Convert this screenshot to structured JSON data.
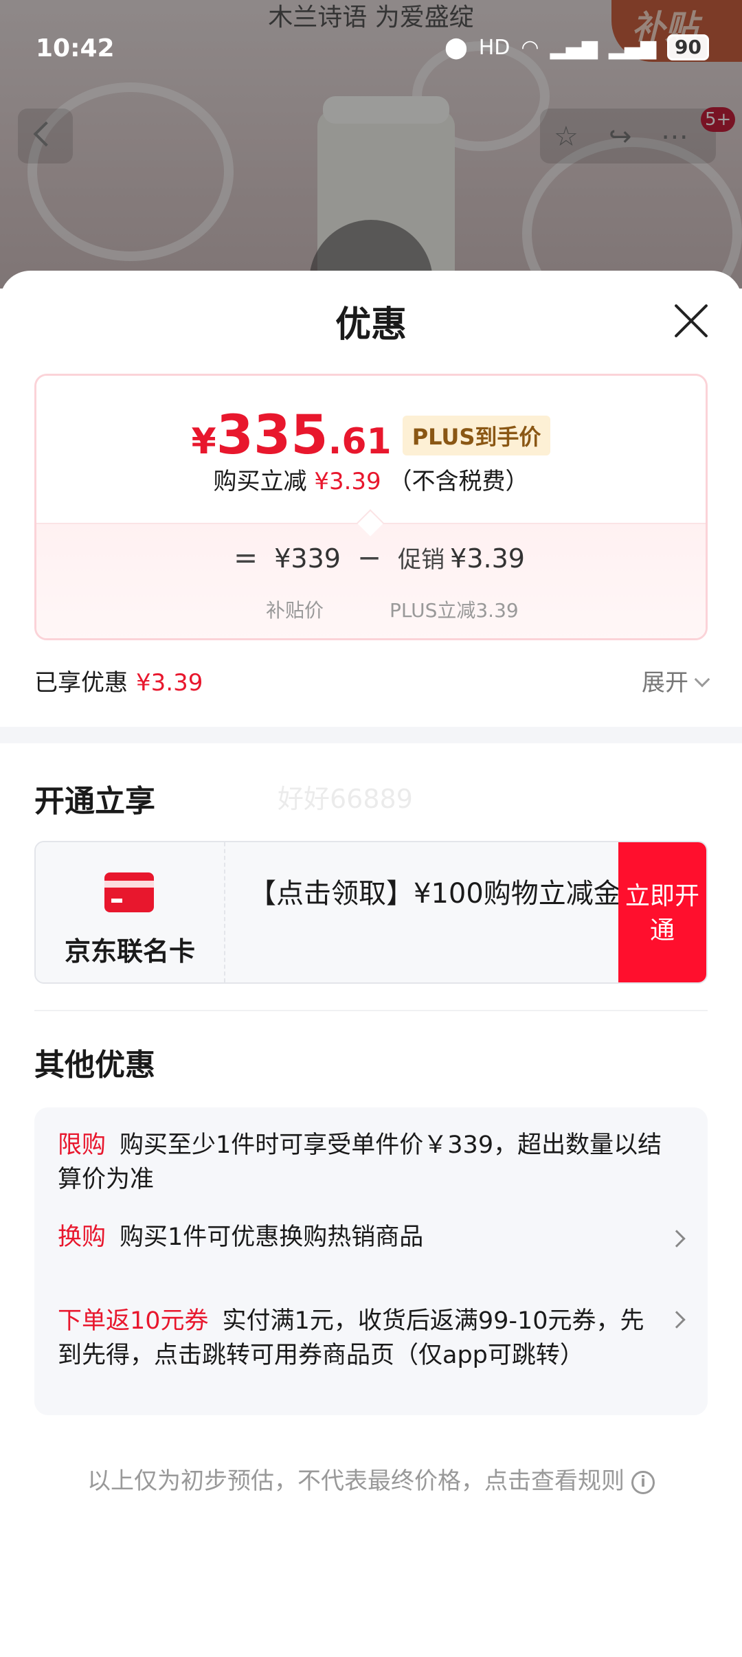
{
  "background": {
    "headline": "木兰诗语 为爱盛绽",
    "subsidy_badge": "补贴",
    "notification_badge": "5+"
  },
  "status_bar": {
    "time": "10:42",
    "battery": "90"
  },
  "sheet": {
    "title": "优惠",
    "price": {
      "yen": "¥",
      "integer": "335",
      "decimal": ".61",
      "tag": "PLUS到手价",
      "subtitle_prefix": "购买立减",
      "subtitle_amount": "¥3.39",
      "subtitle_suffix": "（不含税费）"
    },
    "formula": {
      "equals": "=",
      "base_price": "¥339",
      "minus": "−",
      "promo_label": "促销",
      "promo_amount": "¥3.39",
      "base_label": "补贴价",
      "promo_detail": "PLUS立减3.39"
    },
    "enjoyed": {
      "label": "已享优惠",
      "amount": "¥3.39",
      "expand": "展开"
    },
    "section_open": {
      "title": "开通立享",
      "watermark": "好好66889",
      "card_name": "京东联名卡",
      "card_desc": "【点击领取】¥100购物立减金",
      "button": "立即开通"
    },
    "section_other": {
      "title": "其他优惠",
      "offers": [
        {
          "tag": "限购",
          "text": "购买至少1件时可享受单件价￥339，超出数量以结算价为准"
        },
        {
          "tag": "换购",
          "text": "购买1件可优惠换购热销商品"
        },
        {
          "tag": "下单返10元券",
          "text": "实付满1元，收货后返满99-10元券，先到先得，点击跳转可用券商品页（仅app可跳转）"
        }
      ]
    },
    "disclaimer": "以上仅为初步预估，不代表最终价格，点击查看规则"
  }
}
